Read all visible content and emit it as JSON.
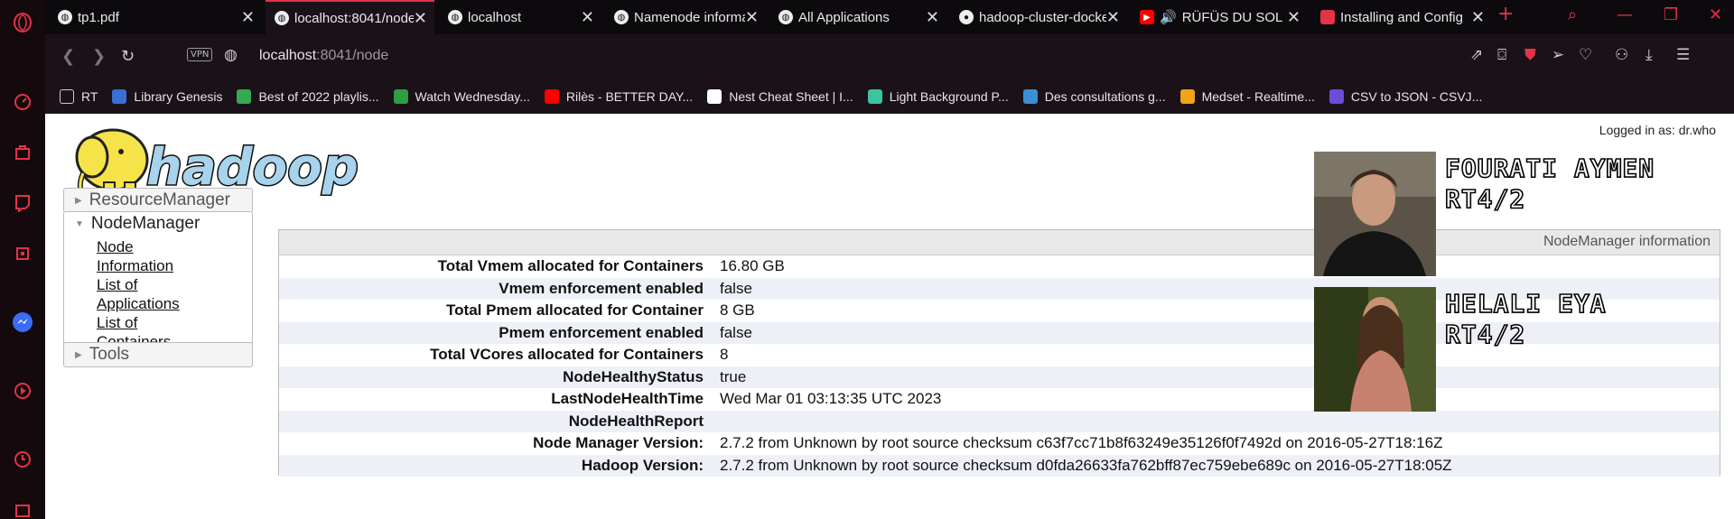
{
  "browser": {
    "tabs": [
      {
        "title": "tp1.pdf",
        "icon": "globe-icon"
      },
      {
        "title": "localhost:8041/node",
        "icon": "globe-icon",
        "active": true
      },
      {
        "title": "localhost",
        "icon": "globe-icon"
      },
      {
        "title": "Namenode information",
        "icon": "globe-icon"
      },
      {
        "title": "All Applications",
        "icon": "globe-icon"
      },
      {
        "title": "hadoop-cluster-docker",
        "icon": "github-icon"
      },
      {
        "title": "RÜFÜS DU SOL",
        "icon": "youtube-icon"
      },
      {
        "title": "Installing and Config",
        "icon": "bookmark-icon"
      }
    ],
    "address": {
      "vpn": "VPN",
      "url_host": "localhost",
      "url_path": ":8041/node"
    },
    "bookmarks": [
      {
        "label": "RT",
        "color": "#cccccc"
      },
      {
        "label": "Library Genesis",
        "color": "#3a6fd8"
      },
      {
        "label": "Best of 2022 playlis...",
        "color": "#34a853"
      },
      {
        "label": "Watch Wednesday...",
        "color": "#2e9e44"
      },
      {
        "label": "Rilès - BETTER DAY...",
        "color": "#ff0000"
      },
      {
        "label": "Nest Cheat Sheet | I...",
        "color": "#ffffff"
      },
      {
        "label": "Light Background P...",
        "color": "#3cc3a0"
      },
      {
        "label": "Des consultations g...",
        "color": "#3c8ed8"
      },
      {
        "label": "Medset - Realtime...",
        "color": "#f2a21b"
      },
      {
        "label": "CSV to JSON - CSVJ...",
        "color": "#6b4bd8"
      }
    ]
  },
  "page": {
    "logged_in": "Logged in as: dr.who",
    "logo_text": "hadoop",
    "nav": {
      "resource_manager": "ResourceManager",
      "node_manager": "NodeManager",
      "links": [
        "Node Information",
        "List of Applications",
        "List of Containers"
      ],
      "tools": "Tools"
    },
    "info_title": "NodeManager information",
    "info_rows": [
      {
        "k": "Total Vmem allocated for Containers",
        "v": "16.80 GB"
      },
      {
        "k": "Vmem enforcement enabled",
        "v": "false"
      },
      {
        "k": "Total Pmem allocated for Container",
        "v": "8 GB"
      },
      {
        "k": "Pmem enforcement enabled",
        "v": "false"
      },
      {
        "k": "Total VCores allocated for Containers",
        "v": "8"
      },
      {
        "k": "NodeHealthyStatus",
        "v": "true"
      },
      {
        "k": "LastNodeHealthTime",
        "v": "Wed Mar 01 03:13:35 UTC 2023"
      },
      {
        "k": "NodeHealthReport",
        "v": ""
      },
      {
        "k": "Node Manager Version:",
        "v": "2.7.2 from Unknown by root source checksum c63f7cc71b8f63249e35126f0f7492d on 2016-05-27T18:16Z"
      },
      {
        "k": "Hadoop Version:",
        "v": "2.7.2 from Unknown by root source checksum d0fda26633fa762bff87ec759ebe689c on 2016-05-27T18:05Z"
      }
    ],
    "students": [
      {
        "name": "FOURATI AYMEN",
        "group": "RT4/2"
      },
      {
        "name": "HELALI EYA",
        "group": "RT4/2"
      }
    ]
  },
  "colors": {
    "accent": "#e23347",
    "dark": "#14090d"
  }
}
